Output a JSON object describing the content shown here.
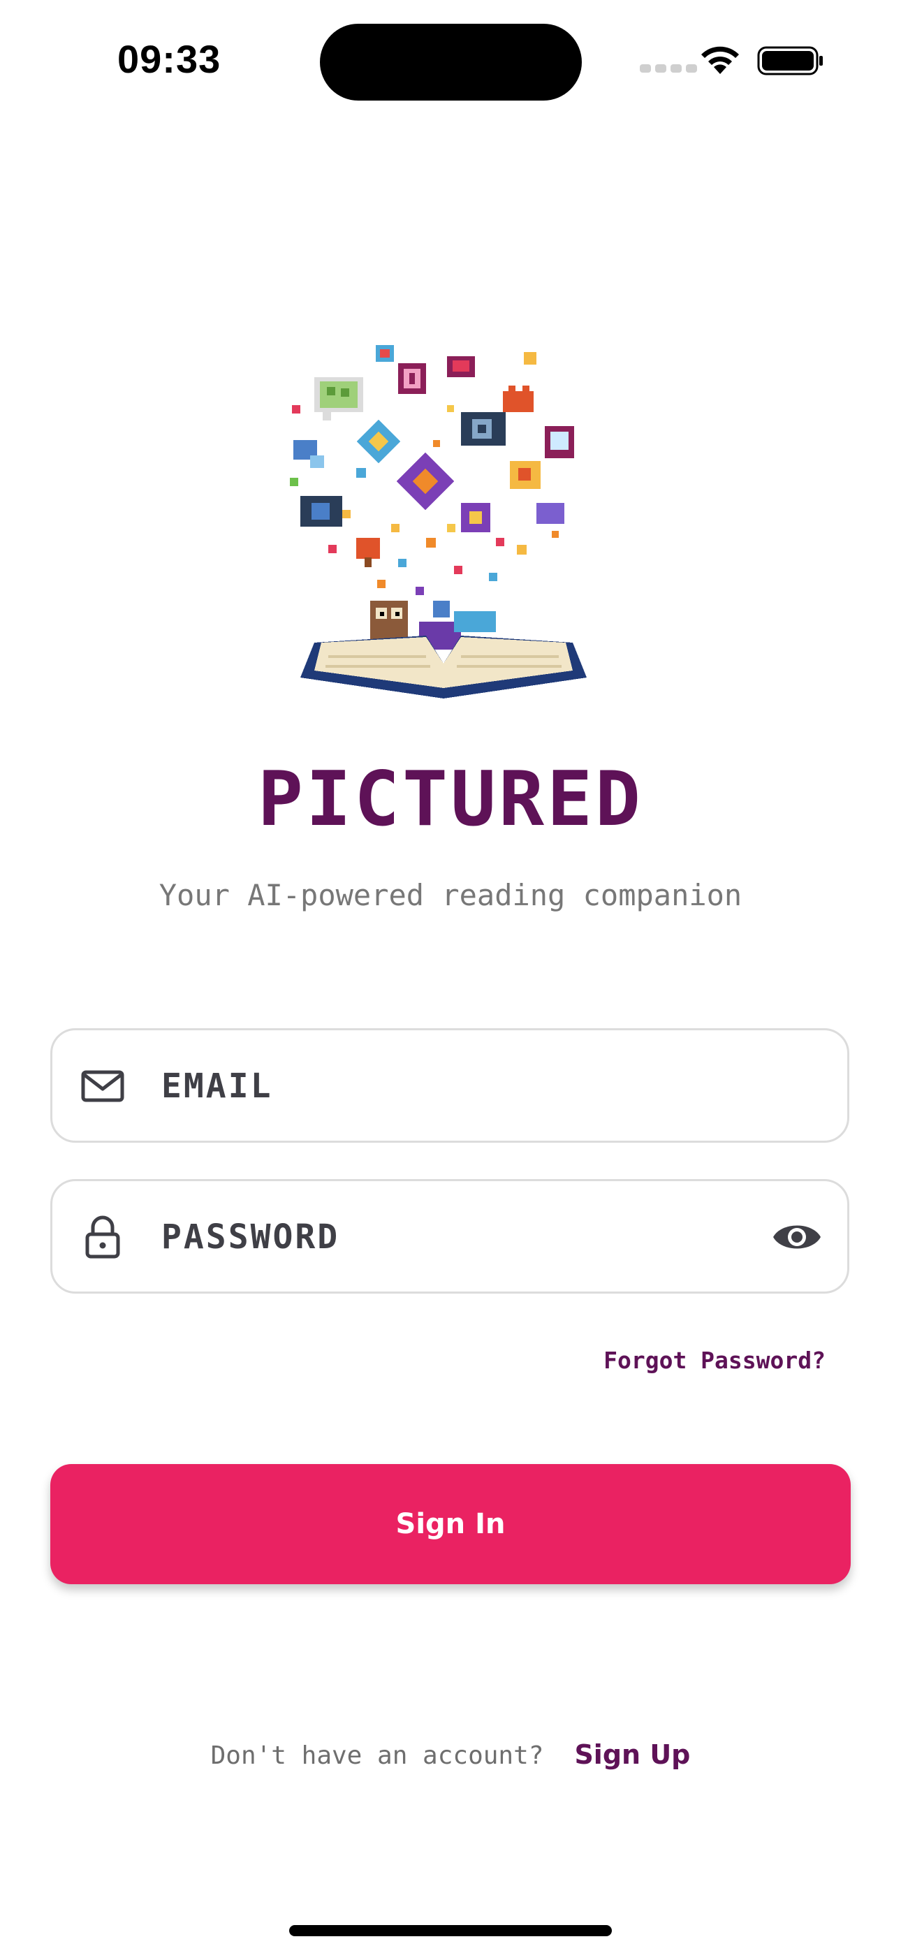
{
  "status_bar": {
    "time": "09:33"
  },
  "app": {
    "title": "PICTURED",
    "subtitle": "Your AI-powered reading companion"
  },
  "form": {
    "email_placeholder": "EMAIL",
    "password_placeholder": "PASSWORD",
    "email_icon": "mail-icon",
    "password_icon": "lock-icon",
    "visibility_icon": "eye-icon"
  },
  "links": {
    "forgot_password": "Forgot Password?"
  },
  "buttons": {
    "sign_in": "Sign In"
  },
  "footer": {
    "prompt": "Don't have an account?",
    "sign_up": "Sign Up"
  },
  "colors": {
    "brand_purple": "#5e1257",
    "primary_button": "#ea2262"
  }
}
